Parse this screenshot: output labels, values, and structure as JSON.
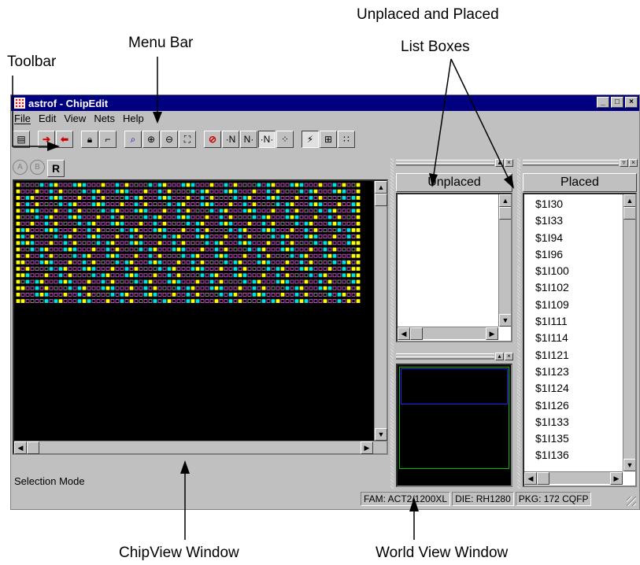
{
  "callouts": {
    "menu_bar": "Menu Bar",
    "toolbar": "Toolbar",
    "list_boxes_line1": "Unplaced and Placed",
    "list_boxes_line2": "List Boxes",
    "chipview": "ChipView Window",
    "worldview": "World View Window"
  },
  "window": {
    "title": "astrof - ChipEdit",
    "controls": [
      "_",
      "□",
      "×"
    ]
  },
  "menu": {
    "file": "File",
    "edit": "Edit",
    "view": "View",
    "nets": "Nets",
    "help": "Help"
  },
  "toolbar_icons": [
    "save-icon",
    "import-icon",
    "export-icon",
    "lock-icon",
    "unlock-icon",
    "zoom-select-icon",
    "zoom-in-icon",
    "zoom-out-icon",
    "zoom-fit-icon",
    "no-nets-icon",
    "net-in-icon",
    "net-out-icon",
    "net-all-icon",
    "scatter-icon",
    "draw-icon",
    "place-icon",
    "grid-icon"
  ],
  "mode_buttons": {
    "a": "A",
    "b": "B",
    "r": "R"
  },
  "status": {
    "mode": "Selection Mode"
  },
  "statusbar": {
    "fam": "FAM: ACT2/1200XL",
    "die": "DIE: RH1280",
    "pkg": "PKG: 172 CQFP"
  },
  "unplaced": {
    "header": "Unplaced",
    "items": []
  },
  "placed": {
    "header": "Placed",
    "items": [
      "$1I30",
      "$1I33",
      "$1I94",
      "$1I96",
      "$1I100",
      "$1I102",
      "$1I109",
      "$1I111",
      "$1I114",
      "$1I121",
      "$1I123",
      "$1I124",
      "$1I126",
      "$1I133",
      "$1I135",
      "$1I136"
    ]
  },
  "colors": {
    "title_bar": "#000080",
    "chip_bg": "#000000",
    "cell_yellow": "#ffff00",
    "cell_cyan": "#00e0e0",
    "cell_magenta": "#e060e0",
    "world_frame": "#00c000",
    "world_view": "#2020ff"
  }
}
